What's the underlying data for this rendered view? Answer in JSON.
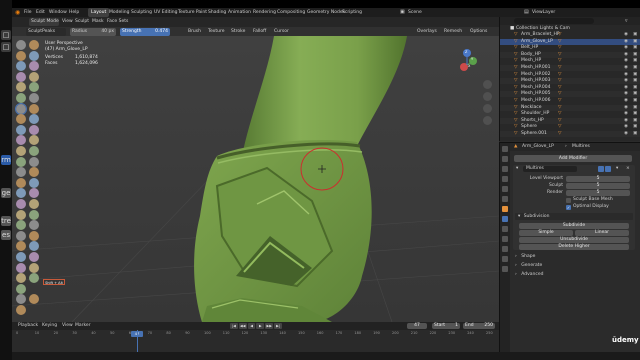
{
  "left_strip": {
    "items": [
      "rm",
      "ge",
      "tre",
      "es"
    ]
  },
  "menubar": {
    "items": [
      "File",
      "Edit",
      "Window",
      "Help"
    ],
    "tabs": [
      "Layout",
      "Modeling",
      "Sculpting",
      "UV Editing",
      "Texture Paint",
      "Shading",
      "Animation",
      "Rendering",
      "Compositing",
      "Geometry Nodes",
      "Scripting"
    ],
    "active_tab": "Layout",
    "scene": "Scene",
    "view_layer": "ViewLayer"
  },
  "tool_settings": {
    "mode": "Sculpt Mode",
    "menus": [
      "View",
      "Sculpt",
      "Mask",
      "Face Sets"
    ],
    "brush": "SculptPeaks",
    "radius_label": "Radius",
    "radius_value": "40 px",
    "strength_label": "Strength",
    "strength_value": "0.474",
    "dropdowns": [
      "Brush",
      "Texture",
      "Stroke",
      "Falloff",
      "Cursor"
    ],
    "right": [
      "Overlays",
      "Remesh",
      "Options"
    ],
    "axes": [
      "X",
      "Y",
      "Z"
    ]
  },
  "viewport": {
    "view_name": "User Perspective",
    "object_name": "(47) Arm_Glove_LP",
    "stats": [
      {
        "label": "Vertices",
        "value": "1,610,874"
      },
      {
        "label": "Faces",
        "value": "1,624,096"
      }
    ],
    "keystroke": "Shift + Alt"
  },
  "timeline": {
    "menus": [
      "Playback",
      "Keying",
      "View",
      "Marker"
    ],
    "current_frame": "47",
    "start_label": "Start",
    "start": "1",
    "end_label": "End",
    "end": "250",
    "ticks": [
      "0",
      "10",
      "20",
      "30",
      "40",
      "50",
      "60",
      "70",
      "80",
      "90",
      "100",
      "110",
      "120",
      "130",
      "140",
      "150",
      "160",
      "170",
      "180",
      "190",
      "200",
      "210",
      "220",
      "230",
      "240",
      "250"
    ]
  },
  "outliner": {
    "collection": "Collection Lights & Cam",
    "objects": [
      "Arm_Bracelet_HP",
      "Arm_Glove_LP",
      "Belt_HP",
      "Body_HP",
      "Mesh_HP",
      "Mesh_HP.001",
      "Mesh_HP.002",
      "Mesh_HP.003",
      "Mesh_HP.004",
      "Mesh_HP.005",
      "Mesh_HP.006",
      "Necklace",
      "Shoulder_HP",
      "Shorts_HP",
      "Sphere",
      "Sphere.001"
    ]
  },
  "properties": {
    "object": "Arm_Glove_LP",
    "modifier_tab": "Multires",
    "add_modifier": "Add Modifier",
    "modifier_name": "Multires",
    "fields": [
      {
        "label": "Level Viewport",
        "value": "5"
      },
      {
        "label": "Sculpt",
        "value": "5"
      },
      {
        "label": "Render",
        "value": "5"
      }
    ],
    "checkboxes": [
      {
        "label": "Sculpt Base Mesh",
        "checked": false
      },
      {
        "label": "Optimal Display",
        "checked": true
      }
    ],
    "subdivision_header": "Subdivision",
    "buttons": [
      "Subdivide",
      "Simple",
      "Linear",
      "Unsubdivide",
      "Delete Higher"
    ],
    "sections": [
      "Shape",
      "Generate",
      "Advanced"
    ]
  },
  "watermark": "ūdemy",
  "colors": {
    "accent": "#4772b3",
    "object_orange": "#e3913c",
    "brush_ring": "#cc2e2e",
    "skin": "#7aa04a"
  }
}
